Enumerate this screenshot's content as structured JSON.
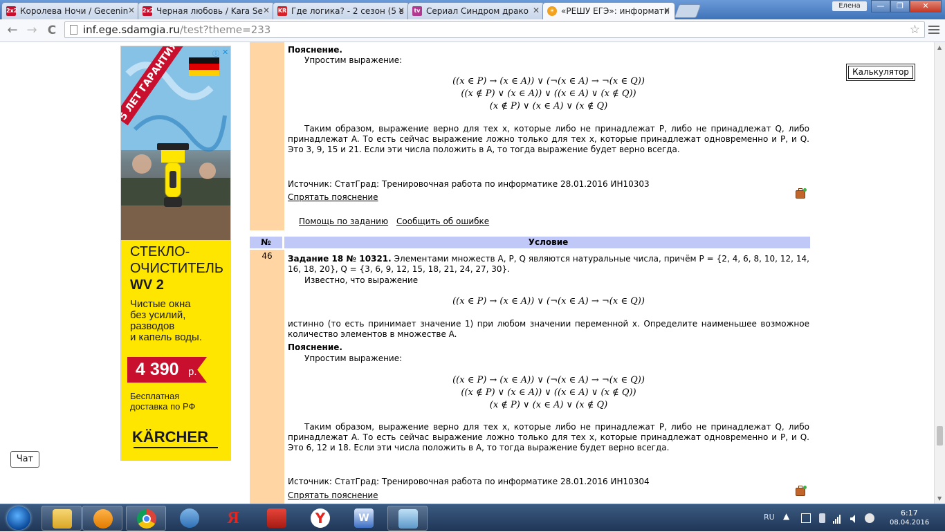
{
  "browser": {
    "tabs": [
      {
        "title": "Королева Ночи / Gecenin",
        "favicon": "2x2",
        "fav_color": "#c8102e",
        "active": false
      },
      {
        "title": "Черная любовь / Kara Se",
        "favicon": "2x2",
        "fav_color": "#c8102e",
        "active": false
      },
      {
        "title": "Где логика? - 2 сезон (5 в",
        "favicon": "KR",
        "fav_color": "#d4232a",
        "active": false
      },
      {
        "title": "Сериал Синдром драко",
        "favicon": "tv",
        "fav_color": "#b0388e",
        "active": false
      },
      {
        "title": "«РЕШУ ЕГЭ»: информати",
        "favicon": "sun",
        "fav_color": "#f2a21c",
        "active": true
      }
    ],
    "user_name": "Елена",
    "url_host": "inf.ege.sdamgia.ru",
    "url_path": "/test?theme=233",
    "window_buttons": {
      "minimize": "—",
      "maximize": "❐",
      "close": "✕"
    },
    "nav": {
      "back": "←",
      "forward": "→",
      "reload": "C"
    }
  },
  "ad": {
    "ribbon": "5 ЛЕТ ГАРАНТИЯ",
    "headline_1": "СТЕКЛО-",
    "headline_2": "ОЧИСТИТЕЛЬ",
    "model": "WV 2",
    "body_1": "Чистые окна",
    "body_2": "без усилий,",
    "body_3": "разводов",
    "body_4": "и капель воды.",
    "price": "4 390",
    "price_unit": "р.",
    "delivery_1": "Бесплатная",
    "delivery_2": "доставка по РФ",
    "brand": "KÄRCHER",
    "info_icon": "ⓘ",
    "close_icon": "✕"
  },
  "chat_label": "Чат",
  "calculator_label": "Калькулятор",
  "task45": {
    "explanation_label": "Пояснение.",
    "simplify": "Упростим выражение:",
    "formula_1": "((x ∈ P) → (x ∈ A)) ∨ (¬(x ∈ A) → ¬(x ∈ Q))",
    "formula_2": "((x ∉ P) ∨ (x ∈ A)) ∨ ((x ∈ A) ∨ (x ∉ Q))",
    "formula_3": "(x ∉ P) ∨ (x ∈ A) ∨ (x ∉ Q)",
    "conclusion": "Таким образом, выражение верно для тех x, которые либо не принадлежат P, либо не принадлежат Q, либо принадлежат A. То есть сейчас выражение ложно только для тех x, которые принадлежат одновременно и P, и Q. Это 3, 9, 15 и 21. Если эти числа положить в A, то тогда выражение будет верно всегда.",
    "source": "Источник: СтатГрад: Тренировочная работа по информатике 28.01.2016 ИН10303",
    "hide_link": "Спрятать пояснение",
    "help_link": "Помощь по заданию",
    "report_link": "Сообщить об ошибке"
  },
  "table_header": {
    "num": "№",
    "condition": "Условие"
  },
  "task46": {
    "num": "46",
    "title": "Задание 18 № 10321.",
    "statement": "Элементами множеств A, P, Q являются натуральные числа, причём P = {2, 4, 6, 8, 10, 12, 14, 16, 18, 20}, Q = {3, 6, 9, 12, 15, 18, 21, 24, 27, 30}.",
    "known": "Известно, что выражение",
    "formula": "((x ∈ P) → (x ∈ A)) ∨ (¬(x ∈ A) → ¬(x ∈ Q))",
    "question": "истинно (то есть принимает значение 1) при любом значении переменной x. Определите наименьшее возможное количество элементов в множестве A.",
    "explanation_label": "Пояснение.",
    "simplify": "Упростим выражение:",
    "formula_1": "((x ∈ P) → (x ∈ A)) ∨ (¬(x ∈ A) → ¬(x ∈ Q))",
    "formula_2": "((x ∉ P) ∨ (x ∈ A)) ∨ ((x ∈ A) ∨ (x ∉ Q))",
    "formula_3": "(x ∉ P) ∨ (x ∈ A) ∨ (x ∉ Q)",
    "conclusion": "Таким образом, выражение верно для тех x, которые либо не принадлежат P, либо не принадлежат Q, либо принадлежат A. То есть сейчас выражение ложно только для тех x, которые принадлежат одновременно и P, и Q. Это 6, 12 и 18. Если эти числа положить в A, то тогда выражение будет верно всегда.",
    "source": "Источник: СтатГрад: Тренировочная работа по информатике 28.01.2016 ИН10304",
    "hide_link": "Спрятать пояснение"
  },
  "taskbar": {
    "apps": [
      "explorer",
      "media-player",
      "chrome",
      "speaker-app",
      "yandex-search",
      "pdf-reader",
      "yandex-browser",
      "word",
      "snipping-tool"
    ],
    "lang": "RU",
    "time": "6:17",
    "date": "08.04.2016"
  }
}
